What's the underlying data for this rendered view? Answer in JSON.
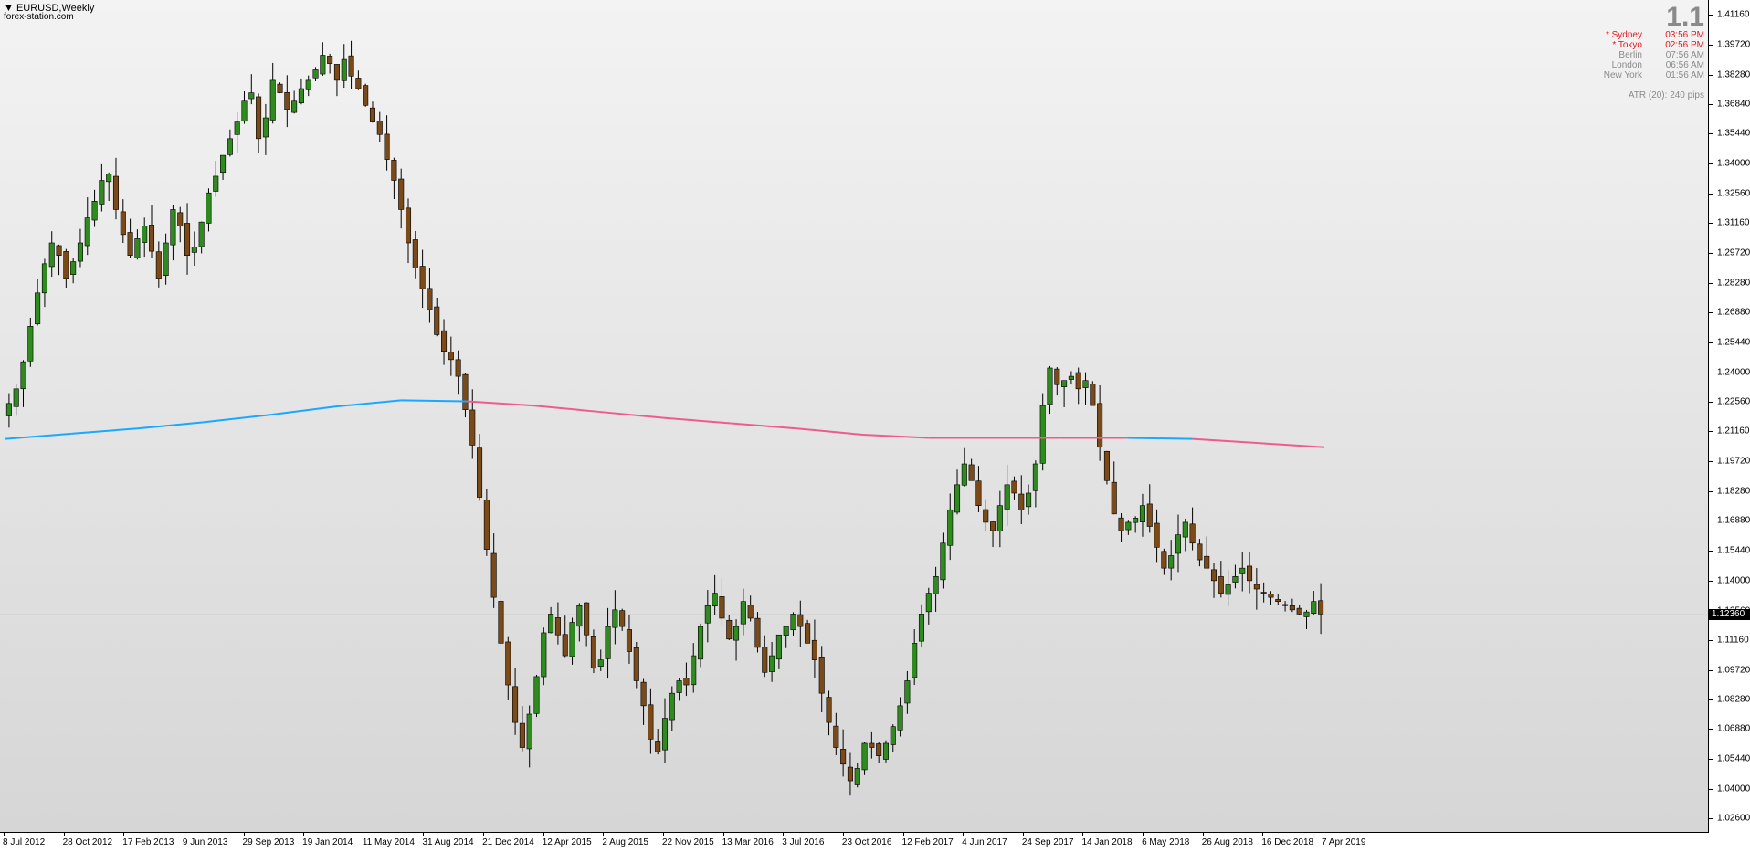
{
  "window": {
    "symbol_title": "EURUSD,Weekly",
    "site": "forex-station.com",
    "big_price": "1.1"
  },
  "clocks": [
    {
      "city": "* Sydney",
      "time": "03:56 PM",
      "color": "#e8141e"
    },
    {
      "city": "* Tokyo",
      "time": "02:56 PM",
      "color": "#e8141e"
    },
    {
      "city": "Berlin",
      "time": "07:56 AM",
      "color": "#8a8a8a"
    },
    {
      "city": "London",
      "time": "06:56 AM",
      "color": "#8a8a8a"
    },
    {
      "city": "New York",
      "time": "01:56 AM",
      "color": "#8a8a8a"
    }
  ],
  "atr_text": "ATR (20): 240 pips",
  "current_price": "1.12360",
  "colors": {
    "bull": "#2f8a1f",
    "bear": "#7a4a18",
    "ma_up": "#19a8ff",
    "ma_down": "#ee5c8c",
    "background_top": "#f3f3f3"
  },
  "chart_data": {
    "type": "candlestick",
    "y_ticks": [
      "1.41160",
      "1.39720",
      "1.38280",
      "1.36840",
      "1.35440",
      "1.34000",
      "1.32560",
      "1.31160",
      "1.29720",
      "1.28280",
      "1.26880",
      "1.25440",
      "1.24000",
      "1.22560",
      "1.21160",
      "1.19720",
      "1.18280",
      "1.16880",
      "1.15440",
      "1.14000",
      "1.12560",
      "1.11160",
      "1.09720",
      "1.08280",
      "1.06880",
      "1.05440",
      "1.04000",
      "1.02600"
    ],
    "ylim": [
      1.0195,
      1.4185
    ],
    "x_ticks": [
      "8 Jul 2012",
      "28 Oct 2012",
      "17 Feb 2013",
      "9 Jun 2013",
      "29 Sep 2013",
      "19 Jan 2014",
      "11 May 2014",
      "31 Aug 2014",
      "21 Dec 2014",
      "12 Apr 2015",
      "2 Aug 2015",
      "22 Nov 2015",
      "13 Mar 2016",
      "3 Jul 2016",
      "23 Oct 2016",
      "12 Feb 2017",
      "4 Jun 2017",
      "24 Sep 2017",
      "14 Jan 2018",
      "6 May 2018",
      "26 Aug 2018",
      "16 Dec 2018",
      "7 Apr 2019"
    ],
    "close_path": [
      1.225,
      1.232,
      1.245,
      1.262,
      1.278,
      1.292,
      1.302,
      1.296,
      1.285,
      1.293,
      1.302,
      1.314,
      1.322,
      1.332,
      1.335,
      1.318,
      1.306,
      1.296,
      1.304,
      1.31,
      1.298,
      1.285,
      1.302,
      1.318,
      1.31,
      1.296,
      1.3,
      1.312,
      1.326,
      1.334,
      1.344,
      1.352,
      1.36,
      1.37,
      1.374,
      1.352,
      1.362,
      1.38,
      1.374,
      1.366,
      1.37,
      1.376,
      1.38,
      1.385,
      1.392,
      1.388,
      1.38,
      1.39,
      1.382,
      1.376,
      1.368,
      1.36,
      1.354,
      1.342,
      1.332,
      1.318,
      1.302,
      1.29,
      1.28,
      1.27,
      1.258,
      1.25,
      1.246,
      1.238,
      1.222,
      1.205,
      1.18,
      1.155,
      1.132,
      1.11,
      1.09,
      1.072,
      1.06,
      1.076,
      1.094,
      1.115,
      1.124,
      1.114,
      1.104,
      1.12,
      1.128,
      1.114,
      1.098,
      1.102,
      1.118,
      1.126,
      1.118,
      1.106,
      1.092,
      1.08,
      1.064,
      1.058,
      1.074,
      1.086,
      1.092,
      1.09,
      1.104,
      1.118,
      1.128,
      1.134,
      1.122,
      1.112,
      1.118,
      1.13,
      1.122,
      1.108,
      1.096,
      1.104,
      1.114,
      1.118,
      1.124,
      1.118,
      1.11,
      1.102,
      1.086,
      1.072,
      1.06,
      1.052,
      1.044,
      1.05,
      1.062,
      1.06,
      1.056,
      1.062,
      1.07,
      1.08,
      1.092,
      1.11,
      1.124,
      1.134,
      1.142,
      1.158,
      1.174,
      1.186,
      1.196,
      1.188,
      1.176,
      1.168,
      1.164,
      1.176,
      1.186,
      1.182,
      1.174,
      1.182,
      1.196,
      1.224,
      1.242,
      1.234,
      1.236,
      1.238,
      1.232,
      1.236,
      1.224,
      1.204,
      1.188,
      1.172,
      1.164,
      1.168,
      1.17,
      1.176,
      1.166,
      1.156,
      1.146,
      1.152,
      1.162,
      1.168,
      1.158,
      1.15,
      1.146,
      1.14,
      1.134,
      1.138,
      1.142,
      1.146,
      1.14,
      1.136,
      1.134,
      1.132,
      1.13,
      1.128,
      1.126,
      1.124,
      1.125,
      1.13,
      1.124
    ],
    "ma_values": [
      1.208,
      1.2105,
      1.213,
      1.216,
      1.2195,
      1.2235,
      1.2265,
      1.226,
      1.224,
      1.221,
      1.218,
      1.2155,
      1.213,
      1.21,
      1.2085,
      1.2085,
      1.2085,
      1.2085,
      1.208,
      1.206,
      1.204
    ],
    "ma_color_by_segment": [
      "up",
      "up",
      "up",
      "up",
      "up",
      "up",
      "up",
      "down",
      "down",
      "down",
      "down",
      "down",
      "down",
      "down",
      "down",
      "down",
      "down",
      "up",
      "down",
      "down"
    ]
  }
}
